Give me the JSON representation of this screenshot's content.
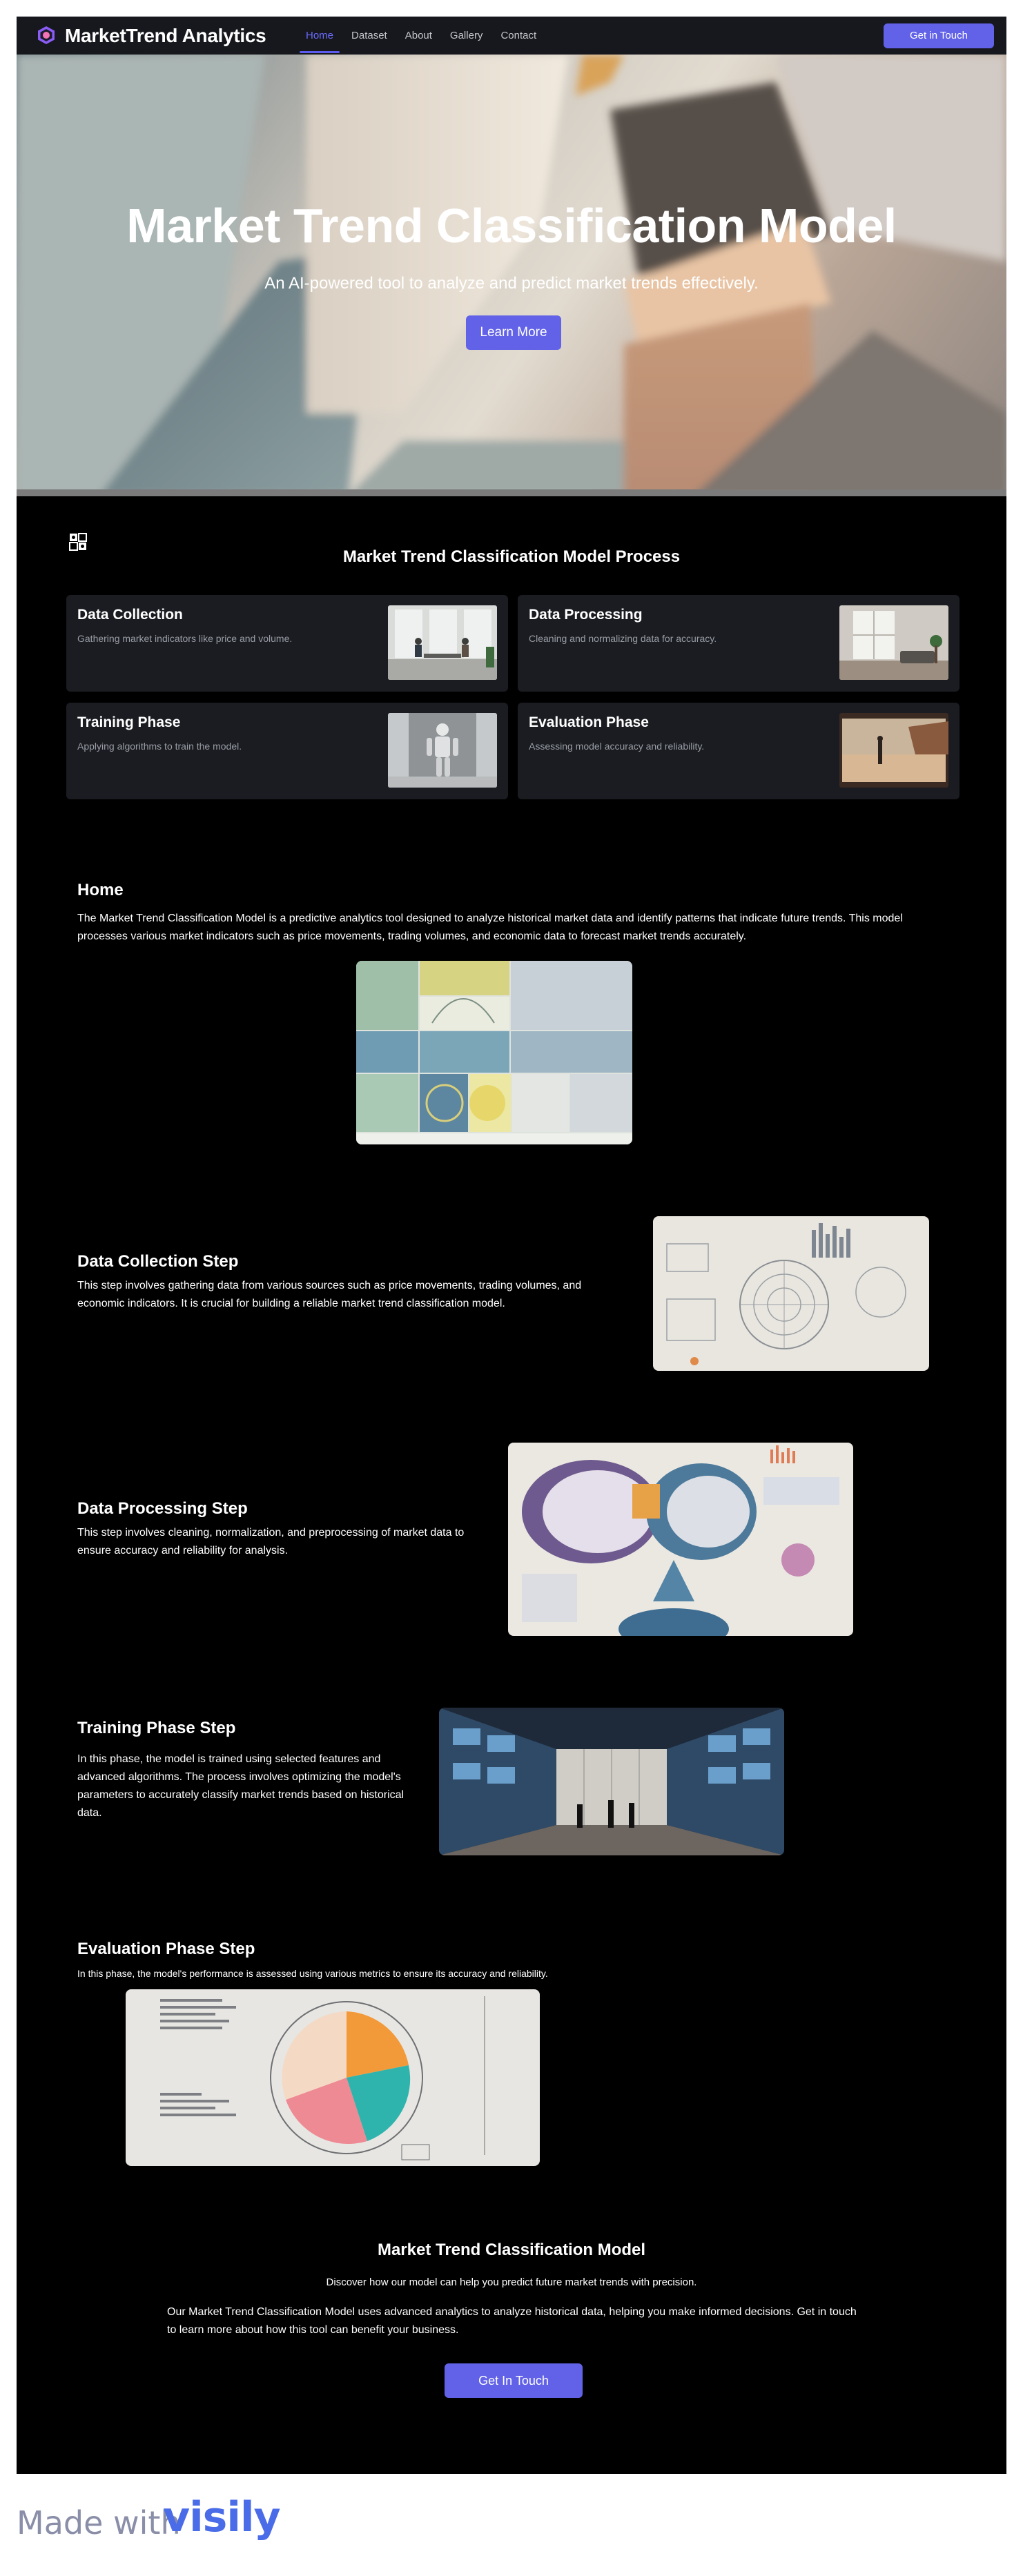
{
  "nav": {
    "brand": "MarketTrend Analytics",
    "links": [
      "Home",
      "Dataset",
      "About",
      "Gallery",
      "Contact"
    ],
    "cta": "Get in Touch"
  },
  "hero": {
    "title": "Market Trend Classification Model",
    "subtitle": "An AI-powered tool to analyze and predict market trends effectively.",
    "button": "Learn More"
  },
  "process": {
    "title": "Market Trend Classification Model Process",
    "cards": [
      {
        "title": "Data Collection",
        "text": "Gathering market indicators like price and volume."
      },
      {
        "title": "Data Processing",
        "text": "Cleaning and normalizing data for accuracy."
      },
      {
        "title": "Training Phase",
        "text": "Applying algorithms to train the model."
      },
      {
        "title": "Evaluation Phase",
        "text": "Assessing model accuracy and reliability."
      }
    ]
  },
  "home": {
    "title": "Home",
    "text": "The Market Trend Classification Model is a predictive analytics tool designed to analyze historical market data and identify patterns that indicate future trends. This model processes various market indicators such as price movements, trading volumes, and economic data to forecast market trends accurately."
  },
  "collection": {
    "title": "Data Collection Step",
    "text": "This step involves gathering data from various sources such as price movements, trading volumes, and economic indicators. It is crucial for building a reliable market trend classification model."
  },
  "processing": {
    "title": "Data Processing Step",
    "text": "This step involves cleaning, normalization, and preprocessing of market data to ensure accuracy and reliability for analysis."
  },
  "training": {
    "title": "Training Phase Step",
    "text": "In this phase, the model is trained using selected features and advanced algorithms. The process involves optimizing the model's parameters to accurately classify market trends based on historical data."
  },
  "evaluation": {
    "title": "Evaluation Phase Step",
    "text": "In this phase, the model's performance is assessed using various metrics to ensure its accuracy and reliability."
  },
  "cta": {
    "title": "Market Trend Classification Model",
    "subtitle": "Discover how our model can help you predict future market trends with precision.",
    "text": "Our Market Trend Classification Model uses advanced analytics to analyze historical data, helping you make informed decisions. Get in touch to learn more about how this tool can benefit your business.",
    "button": "Get In Touch"
  },
  "footer": {
    "made_with": "Made with",
    "brand": "visily"
  },
  "colors": {
    "accent": "#6262e8",
    "nav_bg": "#16181d",
    "card_bg": "#1a1c21",
    "page_bg": "#000000"
  },
  "icons": [
    "hexagon-logo-icon",
    "process-grid-icon"
  ]
}
